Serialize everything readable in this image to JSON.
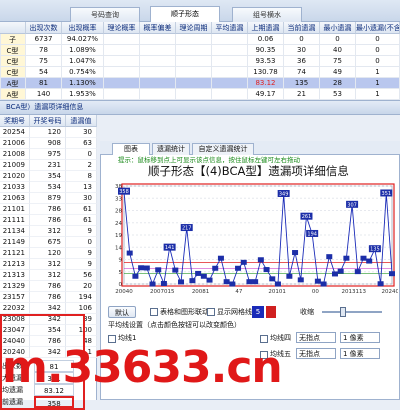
{
  "top_tabs": [
    "号码查询",
    "顺子形态",
    "组号横水"
  ],
  "grid1": {
    "headers": [
      "",
      "出现次数",
      "出现概率",
      "理论概率",
      "概率偏差",
      "理论周期",
      "平均遗漏",
      "上期遗漏",
      "当前遗漏",
      "最小遗漏",
      "最小遗漏(不含0)"
    ],
    "rows": [
      {
        "name": "子",
        "values": [
          "6737",
          "94.027%",
          "",
          "",
          "",
          "",
          "0.06",
          "0",
          "0",
          "0",
          ""
        ]
      },
      {
        "name": "C型",
        "values": [
          "78",
          "1.089%",
          "",
          "",
          "",
          "",
          "90.35",
          "30",
          "40",
          "0",
          ""
        ]
      },
      {
        "name": "C型",
        "values": [
          "75",
          "1.047%",
          "",
          "",
          "",
          "",
          "93.53",
          "36",
          "75",
          "0",
          ""
        ]
      },
      {
        "name": "C型",
        "values": [
          "54",
          "0.754%",
          "",
          "",
          "",
          "",
          "130.78",
          "74",
          "49",
          "1",
          ""
        ]
      },
      {
        "name": "A型",
        "values": [
          "81",
          "1.130%",
          "",
          "",
          "",
          "",
          "83.12",
          "135",
          "28",
          "1",
          ""
        ]
      },
      {
        "name": "A型",
        "values": [
          "140",
          "1.953%",
          "",
          "",
          "",
          "",
          "49.17",
          "21",
          "53",
          "1",
          ""
        ]
      }
    ]
  },
  "section2_title": "BCA型）遗漏项详细信息",
  "left_table": {
    "headers": [
      "奖期号",
      "开奖号码",
      "遗漏值"
    ],
    "rows": [
      [
        "20254",
        "120",
        "30"
      ],
      [
        "21006",
        "908",
        "63"
      ],
      [
        "21008",
        "975",
        "0"
      ],
      [
        "21009",
        "231",
        "2"
      ],
      [
        "21020",
        "354",
        "8"
      ],
      [
        "21033",
        "534",
        "13"
      ],
      [
        "21063",
        "879",
        "30"
      ],
      [
        "21101",
        "786",
        "61"
      ],
      [
        "21111",
        "786",
        "61"
      ],
      [
        "21134",
        "312",
        "9"
      ],
      [
        "21149",
        "675",
        "0"
      ],
      [
        "21121",
        "120",
        "9"
      ],
      [
        "21213",
        "312",
        "9"
      ],
      [
        "21313",
        "312",
        "56"
      ],
      [
        "21329",
        "786",
        "20"
      ],
      [
        "23157",
        "786",
        "194"
      ],
      [
        "22032",
        "342",
        "106"
      ],
      [
        "23008",
        "342",
        "39"
      ],
      [
        "23047",
        "354",
        "100"
      ],
      [
        "24040",
        "786",
        "48"
      ],
      [
        "20240",
        "342",
        "1"
      ]
    ],
    "summary": [
      {
        "label": "出次数",
        "value": "81"
      },
      {
        "label": "大遗漏",
        "value": "351"
      },
      {
        "label": "均遗漏",
        "value": "83.12"
      },
      {
        "label": "前遗漏",
        "value": "358"
      }
    ]
  },
  "chart_tabs": [
    "图表",
    "遗漏统计",
    "自定义遗漏统计"
  ],
  "hint": "提示：鼠标移到点上可显示该点信息，按住鼠标左键可左右拖动",
  "chart_title": "顺子形态【(4)BCA型】遗漏项详细信息",
  "chart_data": {
    "type": "line",
    "y_ticks": [
      "38",
      "33",
      "28",
      "24",
      "19",
      "14",
      "9",
      "5",
      "0"
    ],
    "x": [
      "2004030",
      "2007015",
      "2008147",
      "2010097",
      "2013118",
      "2016033",
      "2020042",
      "2024042"
    ],
    "x_tick_labels": [
      "20040",
      "2007015",
      "20081",
      "47",
      "20101",
      "00",
      "2013113",
      "202404"
    ],
    "values": [
      358,
      120,
      30,
      63,
      62,
      0,
      55,
      2,
      141,
      54,
      8,
      217,
      13,
      41,
      30,
      15,
      61,
      100,
      9,
      0,
      61,
      84,
      9,
      9,
      94,
      56,
      20,
      0,
      349,
      30,
      122,
      16,
      261,
      194,
      11,
      0,
      106,
      39,
      50,
      100,
      307,
      48,
      100,
      89,
      135,
      1,
      351,
      40
    ],
    "labels": [
      "358",
      "",
      "",
      "",
      "",
      "",
      "",
      "",
      "141",
      "",
      "",
      "217",
      "",
      "",
      "",
      "",
      "",
      "",
      "",
      "",
      "",
      "",
      "",
      "",
      "",
      "",
      "",
      "",
      "349",
      "",
      "",
      "",
      "261",
      "194",
      "",
      "",
      "",
      "",
      "",
      "",
      "307",
      "",
      "",
      "",
      "135",
      "",
      "351",
      ""
    ],
    "line_color": "#1a2bb8",
    "label_bg": "#1c2ea8",
    "avg_line_color": "#e02020"
  },
  "controls": {
    "default_btn": "默认",
    "table_link": "表格和图形联动",
    "show_grid": "显示网格线",
    "speed": "5",
    "pick": "收缩",
    "avg_lines": "平均线设置（点击颜色按钮可以改变颜色）",
    "avg_items": [
      "均线1",
      "均线2",
      "均线3",
      "均线四",
      "均线五"
    ],
    "style": "无指点",
    "width": "1 像素"
  },
  "watermark": "m.33633.cn",
  "colors": {
    "accent": "#1a2bb8",
    "highlight_row": "#b9c7ee",
    "red": "#e02020"
  }
}
